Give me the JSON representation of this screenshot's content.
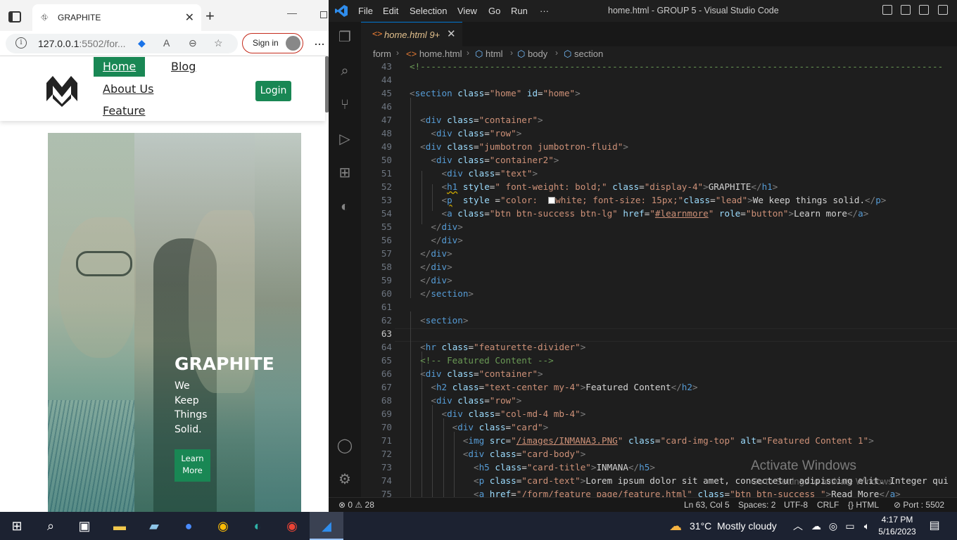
{
  "browser": {
    "tab_title": "GRAPHITE",
    "url_host": "127.0.0.1",
    "url_rest": ":5502/for...",
    "sign_in": "Sign in",
    "site": {
      "nav": {
        "home": "Home",
        "blog": "Blog",
        "about": "About Us",
        "feature": "Feature",
        "login": "Login"
      },
      "hero": {
        "title": "GRAPHITE",
        "subtitle": "We Keep Things Solid.",
        "button": "Learn More"
      }
    }
  },
  "vscode": {
    "menu": [
      "File",
      "Edit",
      "Selection",
      "View",
      "Go",
      "Run",
      "···"
    ],
    "window_title": "home.html - GROUP 5 - Visual Studio Code",
    "tab": {
      "name": "home.html",
      "badge": "9+"
    },
    "breadcrumb": [
      "form",
      "home.html",
      "html",
      "body",
      "section"
    ],
    "line_numbers": [
      "43",
      "44",
      "45",
      "46",
      "47",
      "48",
      "49",
      "50",
      "51",
      "52",
      "53",
      "54",
      "55",
      "56",
      "57",
      "58",
      "59",
      "60",
      "61",
      "62",
      "63",
      "64",
      "65",
      "66",
      "67",
      "68",
      "69",
      "70",
      "71",
      "72",
      "73",
      "74",
      "75"
    ],
    "watermark": {
      "title": "Activate Windows",
      "sub": "Go to Settings to activate Windows."
    },
    "status": {
      "problems": "0",
      "warnings": "28",
      "position": "Ln 63, Col 5",
      "spaces": "Spaces: 2",
      "encoding": "UTF-8",
      "eol": "CRLF",
      "language": "HTML",
      "port": "Port : 5502"
    }
  },
  "taskbar": {
    "weather_temp": "31°C",
    "weather_text": "Mostly cloudy",
    "time": "4:17 PM",
    "date": "5/16/2023"
  },
  "colors": {
    "accent_green": "#198754",
    "vscode_blue": "#0078d4"
  }
}
